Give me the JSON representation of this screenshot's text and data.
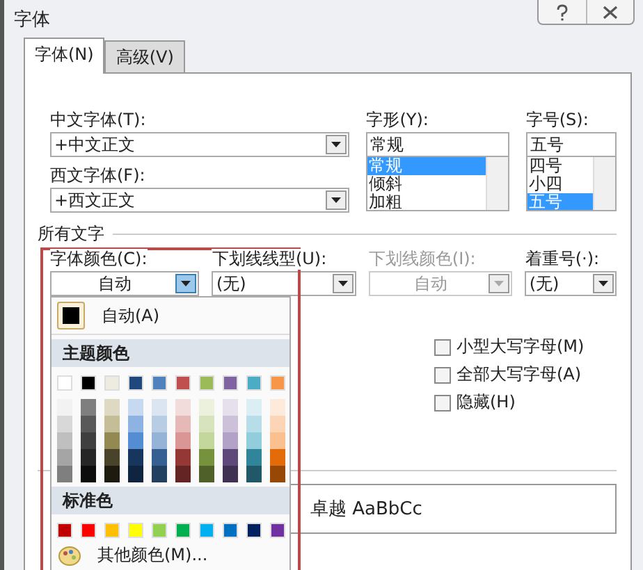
{
  "window": {
    "title": "字体"
  },
  "tabs": [
    {
      "label": "字体(N)",
      "selected": true
    },
    {
      "label": "高级(V)",
      "selected": false
    }
  ],
  "fonts": {
    "chinese": {
      "label": "中文字体(T):",
      "value": "+中文正文"
    },
    "western": {
      "label": "西文字体(F):",
      "value": "+西文正文"
    }
  },
  "lists": [
    {
      "label": "字形(Y):",
      "value": "常规",
      "options": [
        {
          "label": "常规",
          "selected": true
        },
        {
          "label": "倾斜",
          "selected": false
        },
        {
          "label": "加粗",
          "selected": false
        }
      ]
    },
    {
      "label": "字号(S):",
      "value": "五号",
      "options": [
        {
          "label": "四号",
          "selected": false
        },
        {
          "label": "小四",
          "selected": false
        },
        {
          "label": "五号",
          "selected": true
        }
      ]
    }
  ],
  "all_text": {
    "heading": "所有文字",
    "fields": [
      {
        "kind": "color",
        "label": "字体颜色(C):",
        "value": "自动",
        "disabled": false,
        "open": true
      },
      {
        "kind": "style",
        "label": "下划线线型(U):",
        "value": "(无)",
        "disabled": false,
        "open": false
      },
      {
        "kind": "color",
        "label": "下划线颜色(I):",
        "value": "自动",
        "disabled": true,
        "open": false
      },
      {
        "kind": "style",
        "label": "着重号(·):",
        "value": "(无)",
        "disabled": false,
        "open": false
      }
    ]
  },
  "effects": [
    {
      "label": "小型大写字母(M)",
      "checked": false
    },
    {
      "label": "全部大写字母(A)",
      "checked": false
    },
    {
      "label": "隐藏(H)",
      "checked": false
    }
  ],
  "preview": {
    "text": "卓越 AaBbCc"
  },
  "color_menu": {
    "automatic": {
      "label": "自动(A)",
      "color": "#000000"
    },
    "theme_heading": "主题颜色",
    "theme_colors": [
      {
        "color": "#ffffff"
      },
      {
        "color": "#000000"
      },
      {
        "color": "#eeece1"
      },
      {
        "color": "#1f497d"
      },
      {
        "color": "#4f81bd"
      },
      {
        "color": "#c0504d"
      },
      {
        "color": "#9bbb59"
      },
      {
        "color": "#8064a2"
      },
      {
        "color": "#4bacc6"
      },
      {
        "color": "#f79646"
      }
    ],
    "shade_rows": [
      {
        "swatches": [
          {
            "color": "#f2f2f2"
          },
          {
            "color": "#7f7f7f"
          },
          {
            "color": "#ddd9c3"
          },
          {
            "color": "#c6d9f0"
          },
          {
            "color": "#dbe5f1"
          },
          {
            "color": "#f2dcdb"
          },
          {
            "color": "#ebf1dd"
          },
          {
            "color": "#e5e0ec"
          },
          {
            "color": "#dbeef3"
          },
          {
            "color": "#fdeada"
          }
        ]
      },
      {
        "swatches": [
          {
            "color": "#d8d8d8"
          },
          {
            "color": "#595959"
          },
          {
            "color": "#c4bd97"
          },
          {
            "color": "#8db3e2"
          },
          {
            "color": "#b8cce4"
          },
          {
            "color": "#e5b9b7"
          },
          {
            "color": "#d7e3bc"
          },
          {
            "color": "#ccc1d9"
          },
          {
            "color": "#b7dde8"
          },
          {
            "color": "#fbd5b5"
          }
        ]
      },
      {
        "swatches": [
          {
            "color": "#bfbfbf"
          },
          {
            "color": "#3f3f3f"
          },
          {
            "color": "#938953"
          },
          {
            "color": "#548dd4"
          },
          {
            "color": "#95b3d7"
          },
          {
            "color": "#d99694"
          },
          {
            "color": "#c3d69b"
          },
          {
            "color": "#b2a2c7"
          },
          {
            "color": "#92cddc"
          },
          {
            "color": "#fac08f"
          }
        ]
      },
      {
        "swatches": [
          {
            "color": "#a5a5a5"
          },
          {
            "color": "#262626"
          },
          {
            "color": "#494429"
          },
          {
            "color": "#17365d"
          },
          {
            "color": "#366092"
          },
          {
            "color": "#953734"
          },
          {
            "color": "#76923c"
          },
          {
            "color": "#5f497a"
          },
          {
            "color": "#31859b"
          },
          {
            "color": "#e36c09"
          }
        ]
      },
      {
        "swatches": [
          {
            "color": "#7f7f7f"
          },
          {
            "color": "#0c0c0c"
          },
          {
            "color": "#1d1b10"
          },
          {
            "color": "#0f243e"
          },
          {
            "color": "#244061"
          },
          {
            "color": "#632423"
          },
          {
            "color": "#4f6128"
          },
          {
            "color": "#3f3151"
          },
          {
            "color": "#205867"
          },
          {
            "color": "#974806"
          }
        ]
      }
    ],
    "standard_heading": "标准色",
    "standard_colors": [
      {
        "color": "#c00000"
      },
      {
        "color": "#ff0000"
      },
      {
        "color": "#ffc000"
      },
      {
        "color": "#ffff00"
      },
      {
        "color": "#92d050"
      },
      {
        "color": "#00b050"
      },
      {
        "color": "#00b0f0"
      },
      {
        "color": "#0070c0"
      },
      {
        "color": "#002060"
      },
      {
        "color": "#7030a0"
      }
    ],
    "more_colors": "其他颜色(M)..."
  }
}
